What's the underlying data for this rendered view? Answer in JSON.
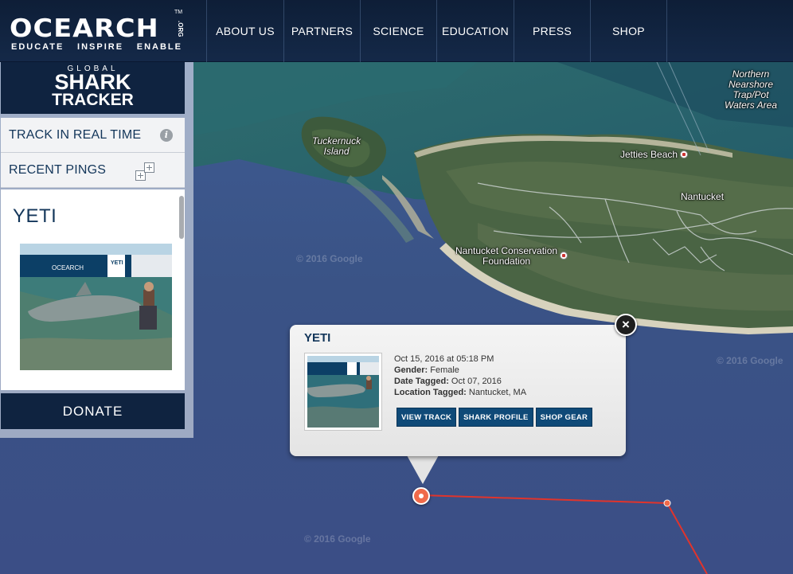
{
  "header": {
    "logo_text": "OCEARCH",
    "logo_suffix": ".ORG",
    "logo_tm": "TM",
    "tagline": [
      "EDUCATE",
      "INSPIRE",
      "ENABLE"
    ],
    "nav": [
      "ABOUT US",
      "PARTNERS",
      "SCIENCE",
      "EDUCATION",
      "PRESS",
      "SHOP"
    ]
  },
  "sidebar": {
    "tracker_logo": {
      "line1": "GLOBAL",
      "line2": "SHARK",
      "line3": "TRACKER"
    },
    "track_label": "TRACK IN REAL TIME",
    "info_icon_glyph": "i",
    "pings_label": "RECENT PINGS",
    "shark_name": "YETI",
    "photo_banner_text": "OCEARCH",
    "photo_brand_text": "YETI",
    "donate_label": "DONATE"
  },
  "map": {
    "labels": {
      "tuckernuck": "Tuckernuck\nIsland",
      "northern": "Northern\nNearshore\nTrap/Pot\nWaters Area",
      "jetties": "Jetties Beach",
      "nantucket": "Nantucket",
      "conservation": "Nantucket Conservation\nFoundation"
    },
    "watermark": "© 2016 Google"
  },
  "popup": {
    "title": "YETI",
    "close_glyph": "×",
    "date": "Oct 15, 2016 at 05:18 PM",
    "gender_label": "Gender:",
    "gender": "Female",
    "tagged_label": "Date Tagged:",
    "tagged": "Oct 07, 2016",
    "location_label": "Location Tagged:",
    "location": "Nantucket, MA",
    "buttons": [
      "VIEW TRACK",
      "SHARK PROFILE",
      "SHOP GEAR"
    ]
  },
  "colors": {
    "navy": "#0f2340",
    "accent": "#13365a",
    "button": "#0f4a78",
    "ping": "#f06a4a",
    "track_line": "#e0342c"
  }
}
